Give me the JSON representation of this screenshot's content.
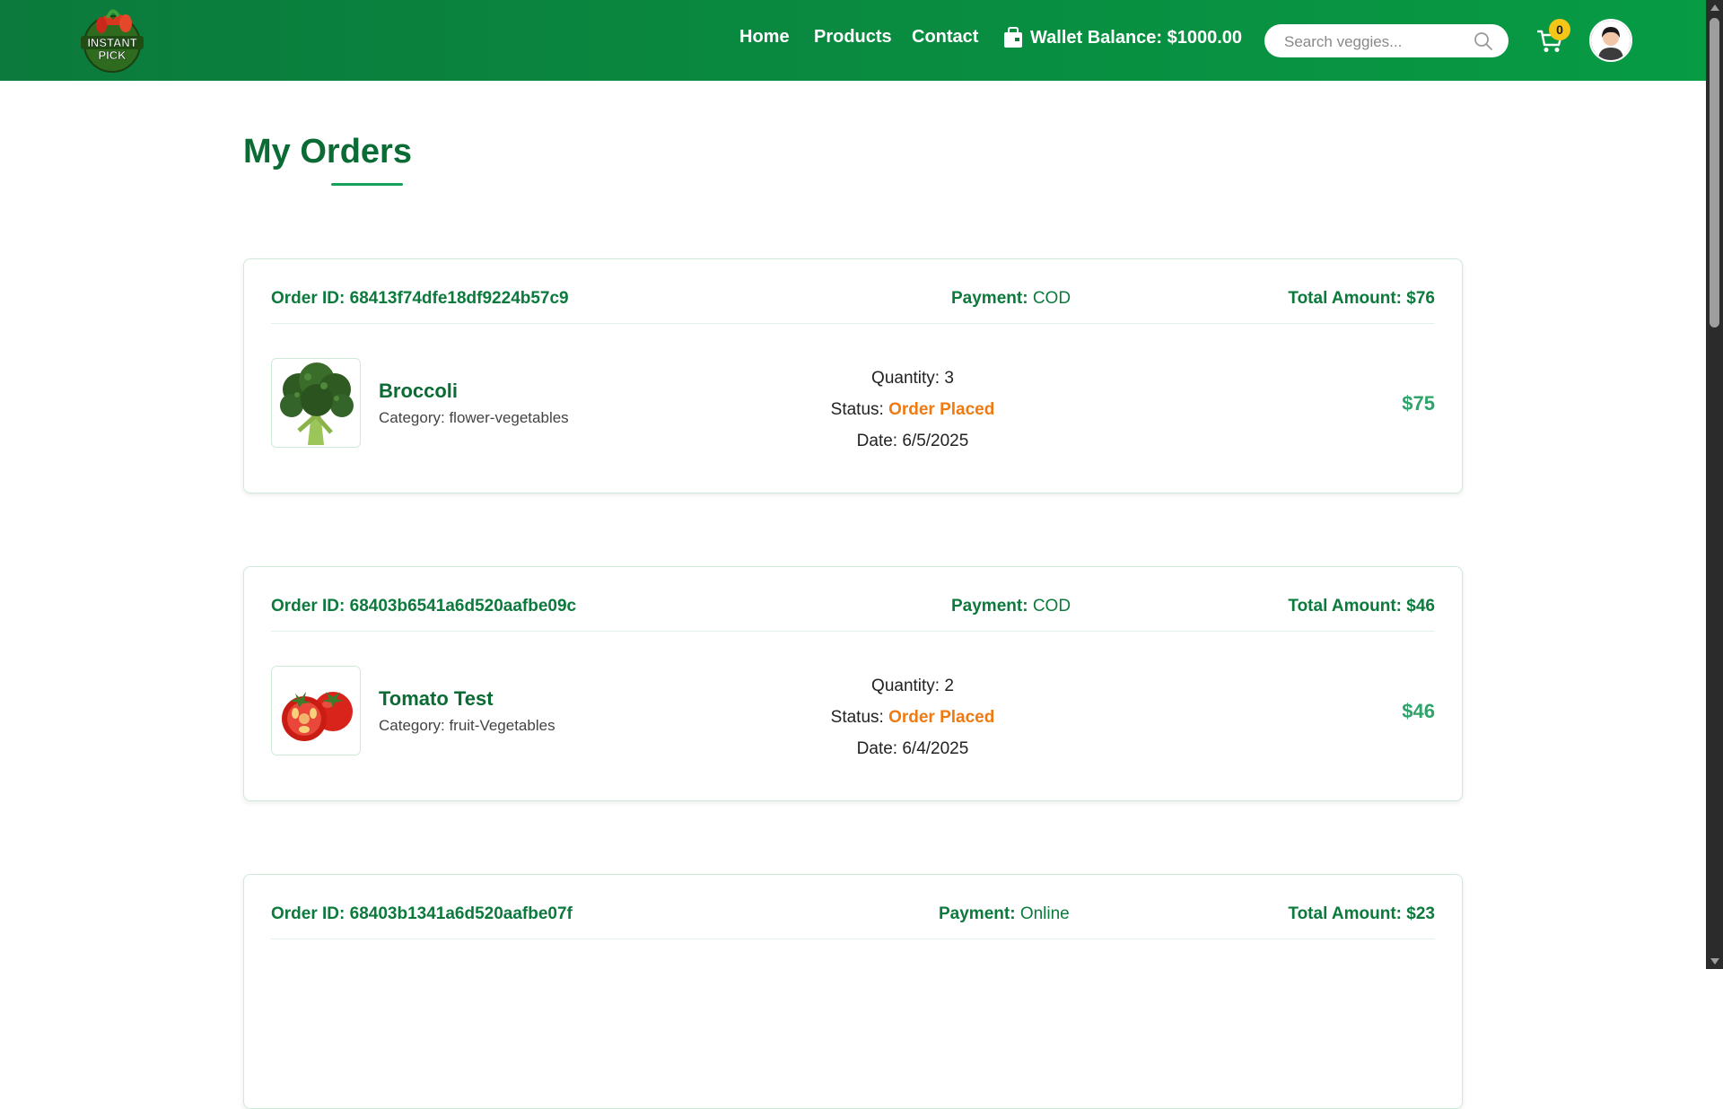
{
  "navbar": {
    "logo_text": [
      "INSTANT",
      "PICK"
    ],
    "links": [
      "Home",
      "Products",
      "Contact"
    ],
    "wallet_label": "Wallet Balance: $1000.00",
    "search_placeholder": "Search veggies...",
    "cart_count": "0",
    "colors": {
      "bar": "#0b7a3c",
      "badge": "#f5c518"
    }
  },
  "main": {
    "title": "My Orders"
  },
  "orders": [
    {
      "order_id_label": "Order ID: 68413f74dfe18df9224b57c9",
      "payment_label": "Payment:",
      "payment_value": "COD",
      "total_label": "Total Amount: $76",
      "product_name": "Broccoli",
      "category_label": "Category:",
      "category_value": "flower-vegetables",
      "quantity_label": "Quantity:",
      "quantity_value": "3",
      "status_label": "Status:",
      "status_value": "Order Placed",
      "date_label": "Date:",
      "date_value": "6/5/2025",
      "price": "$75",
      "image_icon": "broccoli-image"
    },
    {
      "order_id_label": "Order ID: 68403b6541a6d520aafbe09c",
      "payment_label": "Payment:",
      "payment_value": "COD",
      "total_label": "Total Amount: $46",
      "product_name": "Tomato Test",
      "category_label": "Category:",
      "category_value": "fruit-Vegetables",
      "quantity_label": "Quantity:",
      "quantity_value": "2",
      "status_label": "Status:",
      "status_value": "Order Placed",
      "date_label": "Date:",
      "date_value": "6/4/2025",
      "price": "$46",
      "image_icon": "tomato-image"
    },
    {
      "order_id_label": "Order ID: 68403b1341a6d520aafbe07f",
      "payment_label": "Payment:",
      "payment_value": "Online",
      "total_label": "Total Amount: $23"
    }
  ],
  "theme": {
    "primary": "#0b7a3c",
    "status_orange": "#f07a10",
    "price_green": "#2ea36a"
  }
}
